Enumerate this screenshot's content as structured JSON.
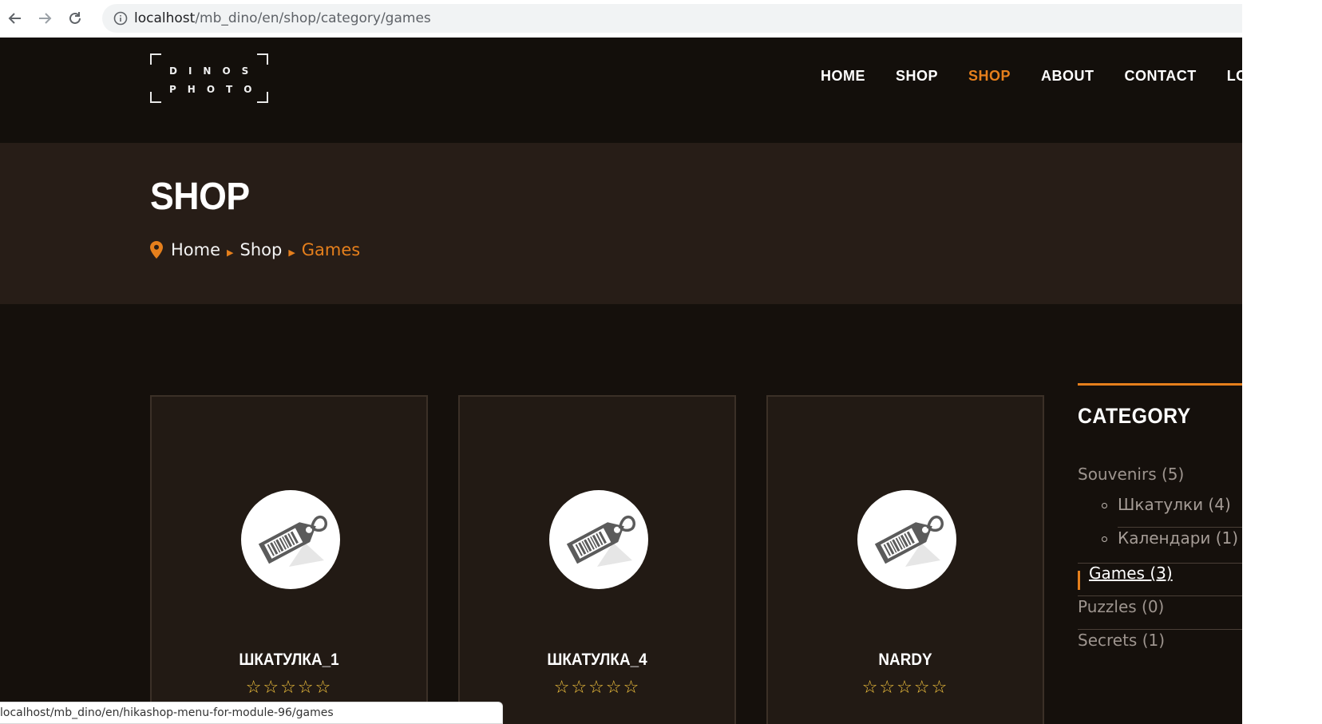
{
  "browser": {
    "url_host": "localhost",
    "url_path": "/mb_dino/en/shop/category/games"
  },
  "logo": {
    "line1": "DINOS",
    "line2": "PHOTO"
  },
  "nav": [
    "HOME",
    "SHOP",
    "SHOP",
    "ABOUT",
    "CONTACT",
    "LOGIN"
  ],
  "banner": {
    "title": "SHOP",
    "breadcrumb": [
      "Home",
      "Shop",
      "Games"
    ]
  },
  "products": [
    {
      "name": "ШКАТУЛКА_1",
      "rating": 0,
      "max_rating": 5
    },
    {
      "name": "ШКАТУЛКА_4",
      "rating": 0,
      "max_rating": 5
    },
    {
      "name": "NARDY",
      "rating": 0,
      "max_rating": 5
    }
  ],
  "sidebar": {
    "heading": "CATEGORY",
    "categories": [
      {
        "label": "Souvenirs (5)"
      },
      {
        "label": "Шкатулки (4)"
      },
      {
        "label": "Календари (1)"
      },
      {
        "label": "Games (3)"
      },
      {
        "label": "Puzzles (0)"
      },
      {
        "label": "Secrets (1)"
      }
    ]
  },
  "status_bar": {
    "text": "localhost/mb_dino/en/hikashop-menu-for-module-96/games"
  },
  "colors": {
    "accent": "#e57f1c",
    "background": "#15100c",
    "banner": "#271d17",
    "card": "#221a14",
    "star": "#f3c33d"
  }
}
